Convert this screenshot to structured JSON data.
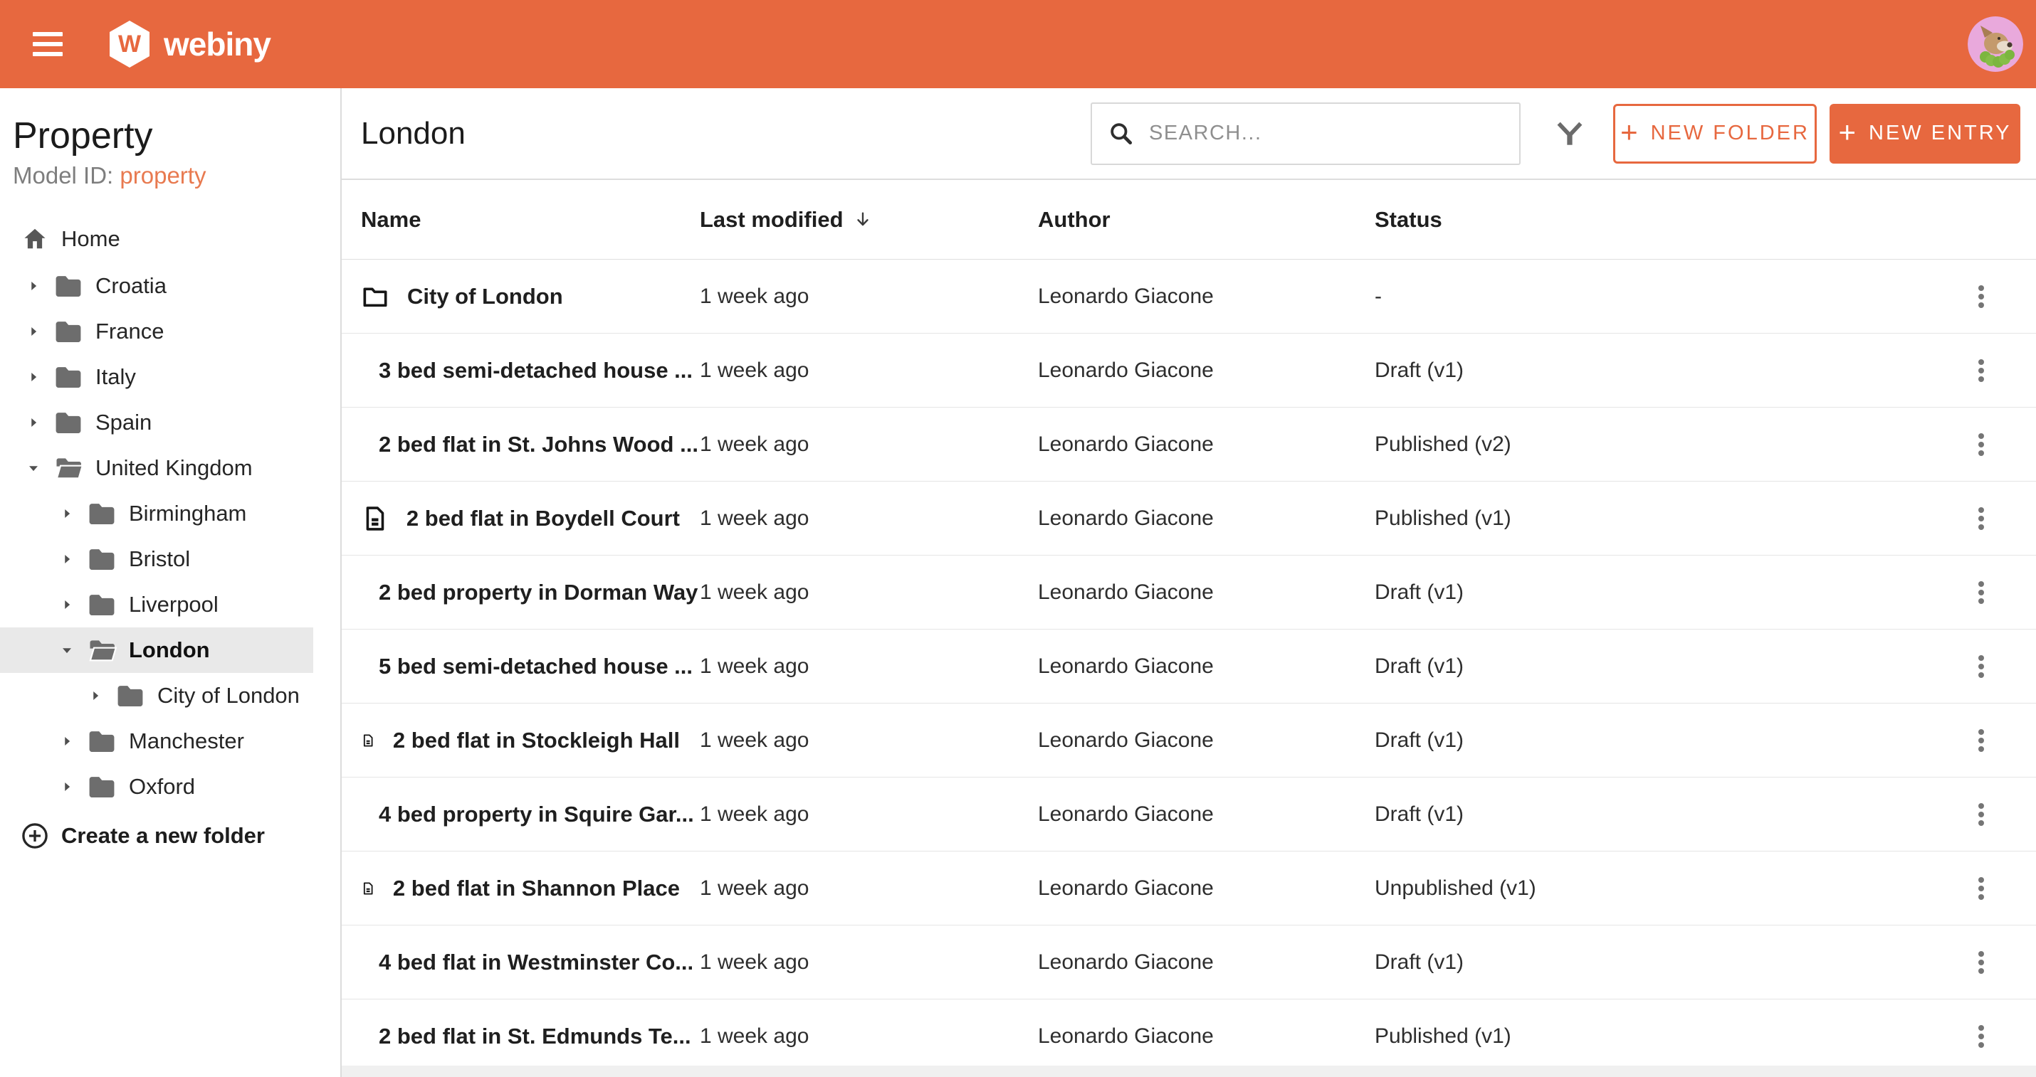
{
  "topbar": {
    "brand": "webiny"
  },
  "sidebar": {
    "title": "Property",
    "model_id_label": "Model ID:",
    "model_id_value": "property",
    "home_label": "Home",
    "tree": [
      {
        "label": "Croatia"
      },
      {
        "label": "France"
      },
      {
        "label": "Italy"
      },
      {
        "label": "Spain"
      },
      {
        "label": "United Kingdom"
      },
      {
        "label": "Birmingham"
      },
      {
        "label": "Bristol"
      },
      {
        "label": "Liverpool"
      },
      {
        "label": "London"
      },
      {
        "label": "City of London"
      },
      {
        "label": "Manchester"
      },
      {
        "label": "Oxford"
      }
    ],
    "create_folder_label": "Create a new folder"
  },
  "main": {
    "title": "London",
    "search_placeholder": "SEARCH...",
    "new_folder_label": "NEW FOLDER",
    "new_entry_label": "NEW ENTRY",
    "table": {
      "columns": [
        "Name",
        "Last modified",
        "Author",
        "Status"
      ],
      "rows": [
        {
          "icon": "folder",
          "name": "City of London",
          "modified": "1 week ago",
          "author": "Leonardo Giacone",
          "status": "-"
        },
        {
          "icon": "document",
          "name": "3 bed semi-detached house ...",
          "modified": "1 week ago",
          "author": "Leonardo Giacone",
          "status": "Draft (v1)"
        },
        {
          "icon": "document",
          "name": "2 bed flat in St. Johns Wood ...",
          "modified": "1 week ago",
          "author": "Leonardo Giacone",
          "status": "Published (v2)"
        },
        {
          "icon": "document",
          "name": "2 bed flat in Boydell Court",
          "modified": "1 week ago",
          "author": "Leonardo Giacone",
          "status": "Published (v1)"
        },
        {
          "icon": "document",
          "name": "2 bed property in Dorman Way",
          "modified": "1 week ago",
          "author": "Leonardo Giacone",
          "status": "Draft (v1)"
        },
        {
          "icon": "document",
          "name": "5 bed semi-detached house ...",
          "modified": "1 week ago",
          "author": "Leonardo Giacone",
          "status": "Draft (v1)"
        },
        {
          "icon": "document",
          "name": "2 bed flat in Stockleigh Hall",
          "modified": "1 week ago",
          "author": "Leonardo Giacone",
          "status": "Draft (v1)"
        },
        {
          "icon": "document",
          "name": "4 bed property in Squire Gar...",
          "modified": "1 week ago",
          "author": "Leonardo Giacone",
          "status": "Draft (v1)"
        },
        {
          "icon": "document",
          "name": "2 bed flat in Shannon Place",
          "modified": "1 week ago",
          "author": "Leonardo Giacone",
          "status": "Unpublished (v1)"
        },
        {
          "icon": "document",
          "name": "4 bed flat in Westminster Co...",
          "modified": "1 week ago",
          "author": "Leonardo Giacone",
          "status": "Draft (v1)"
        },
        {
          "icon": "document",
          "name": "2 bed flat in St. Edmunds Te...",
          "modified": "1 week ago",
          "author": "Leonardo Giacone",
          "status": "Published (v1)"
        }
      ]
    }
  },
  "colors": {
    "accent": "#E7683F",
    "model_link": "#E87A50",
    "selected_bg": "#E9E9E9"
  }
}
